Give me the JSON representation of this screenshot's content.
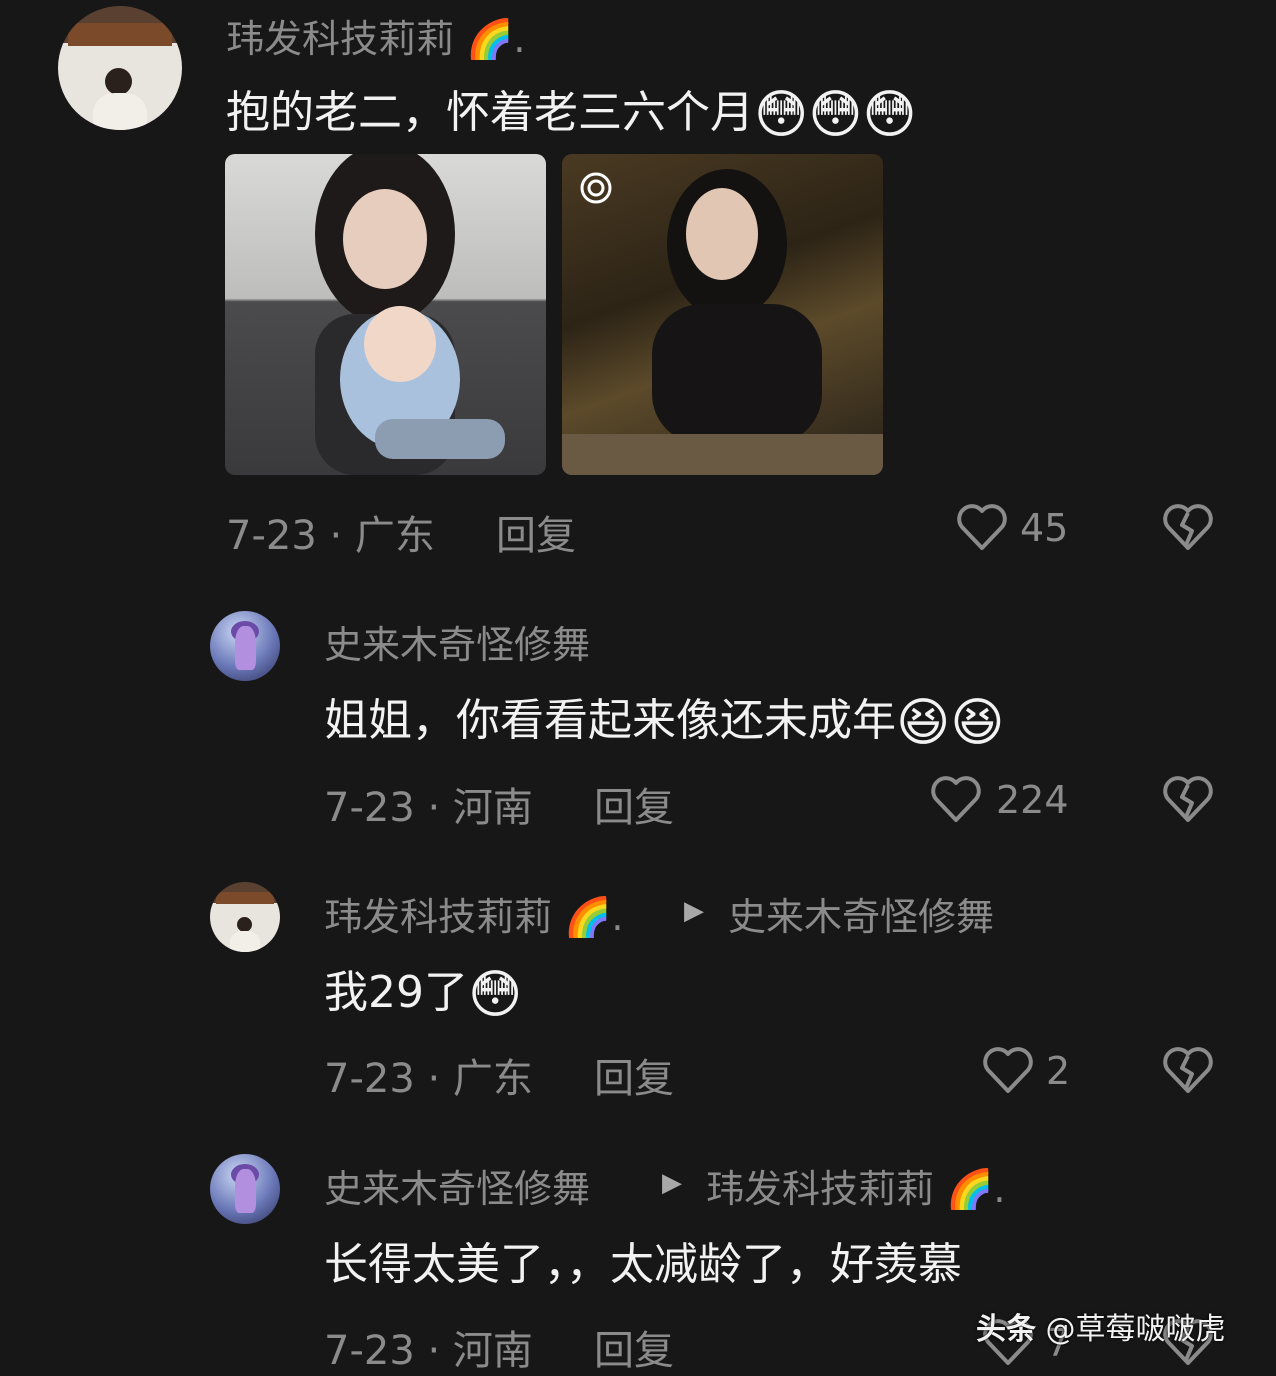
{
  "comments": [
    {
      "username": "玮发科技莉莉",
      "text": "抱的老二，怀着老三六个月",
      "date_loc": "7-23 · 广东",
      "reply": "回复",
      "likes": "45"
    },
    {
      "username": "史来木奇怪修舞",
      "text": "姐姐，你看看起来像还未成年",
      "date_loc": "7-23 · 河南",
      "reply": "回复",
      "likes": "224"
    },
    {
      "username": "玮发科技莉莉",
      "reply_to": "史来木奇怪修舞",
      "text": "我29了",
      "date_loc": "7-23 · 广东",
      "reply": "回复",
      "likes": "2"
    },
    {
      "username": "史来木奇怪修舞",
      "reply_to": "玮发科技莉莉",
      "text": "长得太美了，，太减龄了，好羡慕",
      "date_loc": "7-23 · 河南",
      "reply": "回复",
      "likes": "7"
    }
  ],
  "watermark": {
    "brand": "头条",
    "author": "@草莓啵啵虎"
  },
  "colors": {
    "background": "#171717",
    "muted": "#8b8b8b",
    "text": "#f2f2f2"
  }
}
